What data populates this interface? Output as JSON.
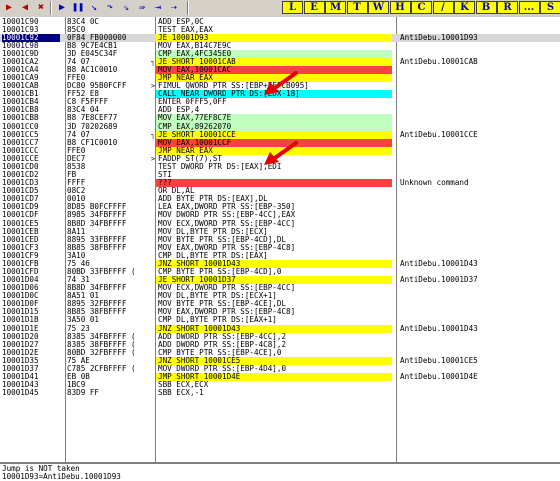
{
  "toolbar": {
    "buttons": [
      {
        "name": "open-icon",
        "glyph": "▶",
        "color": "#c00000"
      },
      {
        "name": "restart-icon",
        "glyph": "◀",
        "color": "#c00000"
      },
      {
        "name": "close-icon",
        "glyph": "✖",
        "color": "#c00000"
      },
      {
        "name": "run-icon",
        "glyph": "▶",
        "color": "#0000c0"
      },
      {
        "name": "pause-icon",
        "glyph": "❚❚",
        "color": "#0000c0"
      },
      {
        "name": "step-into-icon",
        "glyph": "↘",
        "color": "#0000c0"
      },
      {
        "name": "step-over-icon",
        "glyph": "↷",
        "color": "#0000c0"
      },
      {
        "name": "trace-into-icon",
        "glyph": "⇘",
        "color": "#0000c0"
      },
      {
        "name": "trace-over-icon",
        "glyph": "⇛",
        "color": "#0000c0"
      },
      {
        "name": "execute-till-return-icon",
        "glyph": "⇥",
        "color": "#0000c0"
      },
      {
        "name": "goto-icon",
        "glyph": "⇢",
        "color": "#0000c0"
      }
    ],
    "windows": [
      "L",
      "E",
      "M",
      "T",
      "W",
      "H",
      "C",
      "/",
      "K",
      "B",
      "R",
      "...",
      "S"
    ]
  },
  "colors": {
    "accent_blue": "#000080",
    "jmp_yellow": "#ffff00",
    "cmp_green": "#c0ffc0",
    "call_cyan": "#00ffff",
    "highlight_red": "#ff4040",
    "arrow_red": "#e00000"
  },
  "rows": [
    {
      "addr": "10001C90",
      "hex": "83C4 0C",
      "dis": "ADD ESP,0C",
      "com": ""
    },
    {
      "addr": "10001C93",
      "hex": "85C0",
      "dis": "TEST EAX,EAX",
      "com": ""
    },
    {
      "addr": "10001C92",
      "hex": "0F84 FB000000",
      "dis": "JE 10001D93",
      "com": "AntiDebu.10001D93",
      "hl": "jmp",
      "sel": true
    },
    {
      "addr": "10001C98",
      "hex": "B8 9C7E4CB1",
      "dis": "MOV EAX,B14C7E9C",
      "com": ""
    },
    {
      "addr": "10001C9D",
      "hex": "3D E045C34F",
      "dis": "CMP EAX,4FC345E0",
      "com": "",
      "hl": "cmp"
    },
    {
      "addr": "10001CA2",
      "hex": "74 07",
      "dis": "JE SHORT 10001CAB",
      "com": "AntiDebu.10001CAB",
      "hl": "jmp",
      "mark": "v"
    },
    {
      "addr": "10001CA4",
      "hex": "B8 AC1C0010",
      "dis": "MOV EAX,10001CAC",
      "com": "",
      "hl": "red"
    },
    {
      "addr": "10001CA9",
      "hex": "FFE0",
      "dis": "JMP NEAR EAX",
      "com": "",
      "hl": "jmp"
    },
    {
      "addr": "10001CAB",
      "hex": "DC80 95B0FCFF",
      "dis": "FIMUL QWORD PTR SS:[EBP+FFFCB095]",
      "com": "",
      "mark": ">"
    },
    {
      "addr": "10001CB1",
      "hex": "FF52 E8",
      "dis": "CALL NEAR DWORD PTR DS:[EDX-18]",
      "com": "",
      "hl": "call"
    },
    {
      "addr": "10001CB4",
      "hex": "C8 F5FFFF",
      "dis": "ENTER 0FFF5,0FF",
      "com": ""
    },
    {
      "addr": "10001CB8",
      "hex": "83C4 04",
      "dis": "ADD ESP,4",
      "com": ""
    },
    {
      "addr": "10001CBB",
      "hex": "B8 7E8CEF77",
      "dis": "MOV EAX,77EF8C7E",
      "com": "",
      "hl": "cmp"
    },
    {
      "addr": "10001CC0",
      "hex": "3D 70202689",
      "dis": "CMP EAX,89262070",
      "com": "",
      "hl": "cmp"
    },
    {
      "addr": "10001CC5",
      "hex": "74 07",
      "dis": "JE SHORT 10001CCE",
      "com": "AntiDebu.10001CCE",
      "hl": "jmp",
      "mark": "v"
    },
    {
      "addr": "10001CC7",
      "hex": "B8 CF1C0010",
      "dis": "MOV EAX,10001CCF",
      "com": "",
      "hl": "red"
    },
    {
      "addr": "10001CCC",
      "hex": "FFE0",
      "dis": "JMP NEAR EAX",
      "com": "",
      "hl": "jmp"
    },
    {
      "addr": "10001CCE",
      "hex": "DEC7",
      "dis": "FADDP ST(7),ST",
      "com": "",
      "mark": ">"
    },
    {
      "addr": "10001CD0",
      "hex": "8538",
      "dis": "TEST DWORD PTR DS:[EAX],EDI",
      "com": ""
    },
    {
      "addr": "10001CD2",
      "hex": "FB",
      "dis": "STI",
      "com": ""
    },
    {
      "addr": "10001CD3",
      "hex": "FFFF",
      "dis": "???",
      "com": "Unknown command",
      "hl": "red"
    },
    {
      "addr": "10001CD5",
      "hex": "08C2",
      "dis": "OR DL,AL",
      "com": ""
    },
    {
      "addr": "10001CD7",
      "hex": "0010",
      "dis": "ADD BYTE PTR DS:[EAX],DL",
      "com": ""
    },
    {
      "addr": "10001CD9",
      "hex": "8D85 B0FCFFFF",
      "dis": "LEA EAX,DWORD PTR SS:[EBP-350]",
      "com": ""
    },
    {
      "addr": "10001CDF",
      "hex": "8985 34FBFFFF",
      "dis": "MOV DWORD PTR SS:[EBP-4CC],EAX",
      "com": ""
    },
    {
      "addr": "10001CE5",
      "hex": "8B8D 34FBFFFF",
      "dis": "MOV ECX,DWORD PTR SS:[EBP-4CC]",
      "com": ""
    },
    {
      "addr": "10001CEB",
      "hex": "8A11",
      "dis": "MOV DL,BYTE PTR DS:[ECX]",
      "com": ""
    },
    {
      "addr": "10001CED",
      "hex": "8895 33FBFFFF",
      "dis": "MOV BYTE PTR SS:[EBP-4CD],DL",
      "com": ""
    },
    {
      "addr": "10001CF3",
      "hex": "8B85 38FBFFFF",
      "dis": "MOV EAX,DWORD PTR SS:[EBP-4C8]",
      "com": ""
    },
    {
      "addr": "10001CF9",
      "hex": "3A10",
      "dis": "CMP DL,BYTE PTR DS:[EAX]",
      "com": ""
    },
    {
      "addr": "10001CFB",
      "hex": "75 46",
      "dis": "JNZ SHORT 10001D43",
      "com": "AntiDebu.10001D43",
      "hl": "jmp"
    },
    {
      "addr": "10001CFD",
      "hex": "80BD 33FBFFFF (",
      "dis": "CMP BYTE PTR SS:[EBP-4CD],0",
      "com": ""
    },
    {
      "addr": "10001D04",
      "hex": "74 31",
      "dis": "JE SHORT 10001D37",
      "com": "AntiDebu.10001D37",
      "hl": "jmp"
    },
    {
      "addr": "10001D06",
      "hex": "8B8D 34FBFFFF",
      "dis": "MOV ECX,DWORD PTR SS:[EBP-4CC]",
      "com": ""
    },
    {
      "addr": "10001D0C",
      "hex": "8A51 01",
      "dis": "MOV DL,BYTE PTR DS:[ECX+1]",
      "com": ""
    },
    {
      "addr": "10001D0F",
      "hex": "8895 32FBFFFF",
      "dis": "MOV BYTE PTR SS:[EBP-4CE],DL",
      "com": ""
    },
    {
      "addr": "10001D15",
      "hex": "8B85 38FBFFFF",
      "dis": "MOV EAX,DWORD PTR SS:[EBP-4C8]",
      "com": ""
    },
    {
      "addr": "10001D1B",
      "hex": "3A50 01",
      "dis": "CMP DL,BYTE PTR DS:[EAX+1]",
      "com": ""
    },
    {
      "addr": "10001D1E",
      "hex": "75 23",
      "dis": "JNZ SHORT 10001D43",
      "com": "AntiDebu.10001D43",
      "hl": "jmp"
    },
    {
      "addr": "10001D20",
      "hex": "8385 34FBFFFF (",
      "dis": "ADD DWORD PTR SS:[EBP-4CC],2",
      "com": ""
    },
    {
      "addr": "10001D27",
      "hex": "8385 38FBFFFF (",
      "dis": "ADD DWORD PTR SS:[EBP-4C8],2",
      "com": ""
    },
    {
      "addr": "10001D2E",
      "hex": "80BD 32FBFFFF (",
      "dis": "CMP BYTE PTR SS:[EBP-4CE],0",
      "com": ""
    },
    {
      "addr": "10001D35",
      "hex": "75 AE",
      "dis": "JNZ SHORT 10001CE5",
      "com": "AntiDebu.10001CE5",
      "hl": "jmp"
    },
    {
      "addr": "10001D37",
      "hex": "C785 2CFBFFFF (",
      "dis": "MOV DWORD PTR SS:[EBP-4D4],0",
      "com": ""
    },
    {
      "addr": "10001D41",
      "hex": "EB 0B",
      "dis": "JMP SHORT 10001D4E",
      "com": "AntiDebu.10001D4E",
      "hl": "jmp"
    },
    {
      "addr": "10001D43",
      "hex": "1BC9",
      "dis": "SBB ECX,ECX",
      "com": ""
    },
    {
      "addr": "10001D45",
      "hex": "83D9 FF",
      "dis": "SBB ECX,-1",
      "com": ""
    }
  ],
  "info": {
    "line1": "Jump is NOT taken",
    "line2": "10001D93=AntiDebu.10001D93"
  }
}
